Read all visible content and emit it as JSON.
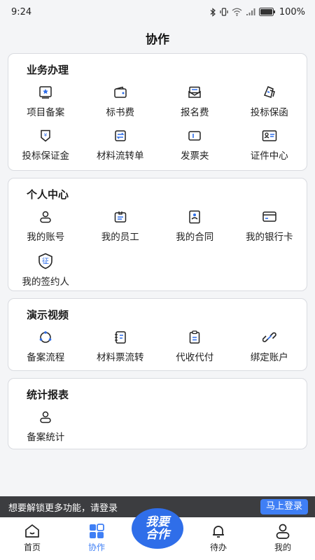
{
  "status": {
    "time": "9:24",
    "battery": "100%"
  },
  "page_title": "协作",
  "sections": [
    {
      "title": "业务办理",
      "items": [
        {
          "label": "项目备案",
          "icon": "project-record-icon"
        },
        {
          "label": "标书费",
          "icon": "bid-fee-icon"
        },
        {
          "label": "报名费",
          "icon": "signup-fee-icon"
        },
        {
          "label": "投标保函",
          "icon": "bid-guarantee-icon"
        },
        {
          "label": "投标保证金",
          "icon": "bid-deposit-icon"
        },
        {
          "label": "材料流转单",
          "icon": "material-transfer-icon"
        },
        {
          "label": "发票夹",
          "icon": "invoice-folder-icon"
        },
        {
          "label": "证件中心",
          "icon": "certificate-icon"
        }
      ]
    },
    {
      "title": "个人中心",
      "items": [
        {
          "label": "我的账号",
          "icon": "account-icon"
        },
        {
          "label": "我的员工",
          "icon": "employee-icon"
        },
        {
          "label": "我的合同",
          "icon": "contract-icon"
        },
        {
          "label": "我的银行卡",
          "icon": "bank-card-icon"
        },
        {
          "label": "我的签约人",
          "icon": "signatory-icon",
          "badge": "征"
        }
      ]
    },
    {
      "title": "演示视频",
      "items": [
        {
          "label": "备案流程",
          "icon": "record-flow-icon"
        },
        {
          "label": "材料票流转",
          "icon": "material-ticket-icon"
        },
        {
          "label": "代收代付",
          "icon": "collect-pay-icon"
        },
        {
          "label": "绑定账户",
          "icon": "bind-account-icon"
        }
      ]
    },
    {
      "title": "统计报表",
      "items": [
        {
          "label": "备案统计",
          "icon": "record-stats-icon"
        }
      ]
    }
  ],
  "login_banner": {
    "text": "想要解锁更多功能，请登录",
    "button": "马上登录"
  },
  "tabbar": {
    "home": "首页",
    "collab": "协作",
    "center_line1": "我要",
    "center_line2": "合作",
    "todo": "待办",
    "mine": "我的"
  },
  "colors": {
    "accent": "#3f7ff5",
    "banner_bg": "#3c3d40"
  }
}
